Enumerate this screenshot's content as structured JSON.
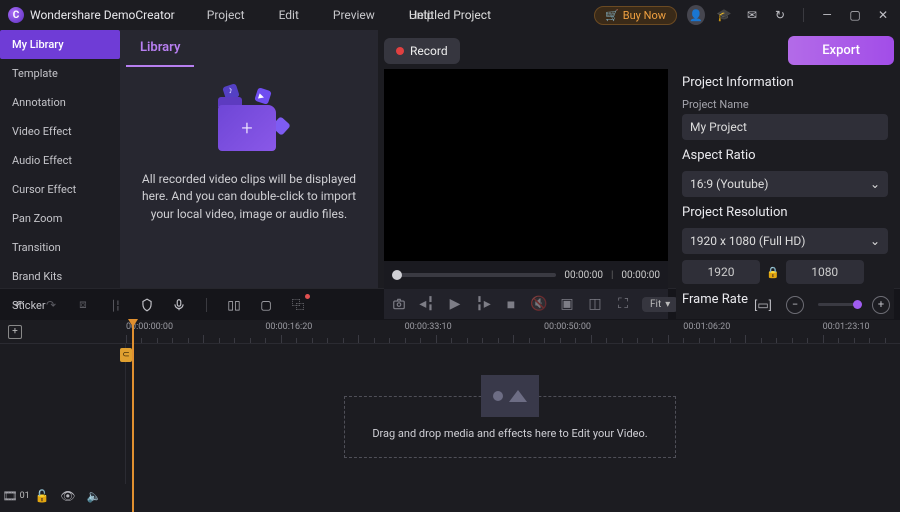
{
  "app": {
    "name": "Wondershare DemoCreator"
  },
  "menu": {
    "project": "Project",
    "edit": "Edit",
    "preview": "Preview",
    "help": "Help"
  },
  "project": {
    "title": "Untitled Project"
  },
  "titlebar": {
    "buy": "Buy Now"
  },
  "sidebar": {
    "items": [
      {
        "label": "My Library"
      },
      {
        "label": "Template"
      },
      {
        "label": "Annotation"
      },
      {
        "label": "Video Effect"
      },
      {
        "label": "Audio Effect"
      },
      {
        "label": "Cursor Effect"
      },
      {
        "label": "Pan Zoom"
      },
      {
        "label": "Transition"
      },
      {
        "label": "Brand Kits"
      },
      {
        "label": "Sticker"
      }
    ]
  },
  "library": {
    "header": "Library",
    "hint": "All recorded video clips will be displayed here. And you can double-click to import your local video, image or audio files."
  },
  "toolbar": {
    "record": "Record",
    "export": "Export"
  },
  "player": {
    "current": "00:00:00",
    "total": "00:00:00",
    "fit": "Fit"
  },
  "info": {
    "heading": "Project Information",
    "name_label": "Project Name",
    "name_value": "My Project",
    "aspect_label": "Aspect Ratio",
    "aspect_value": "16:9 (Youtube)",
    "resolution_label": "Project Resolution",
    "resolution_value": "1920 x 1080 (Full HD)",
    "width": "1920",
    "height": "1080",
    "framerate_label": "Frame Rate"
  },
  "timeline": {
    "ticks": [
      "00:00:00:00",
      "00:00:16:20",
      "00:00:33:10",
      "00:00:50:00",
      "00:01:06:20",
      "00:01:23:10"
    ],
    "drop_hint": "Drag and drop media and effects here to Edit your Video.",
    "track_count": "01"
  }
}
